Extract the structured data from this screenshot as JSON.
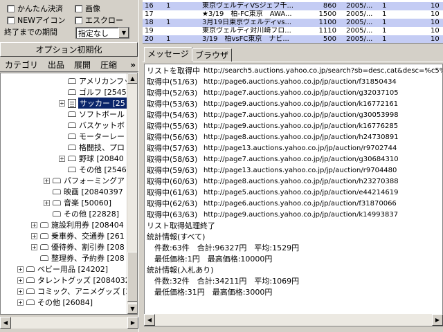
{
  "filters": {
    "row1": [
      {
        "label": "かんたん決済"
      },
      {
        "label": "画像"
      }
    ],
    "row2": [
      {
        "label": "NEWアイコン"
      },
      {
        "label": "エスクロー"
      }
    ],
    "period_label": "終了までの期間",
    "period_value": "指定なし"
  },
  "reset_button": "オプション初期化",
  "left_tabs": [
    "カテゴリ",
    "出品",
    "展開",
    "圧縮"
  ],
  "left_tabs_more": "»",
  "tree": [
    {
      "text": "アメリカンフッ",
      "level": 4,
      "expander": ""
    },
    {
      "text": "ゴルフ [2545",
      "level": 4,
      "expander": ""
    },
    {
      "text": "サッカー [25",
      "level": 4,
      "expander": "+",
      "selected": true
    },
    {
      "text": "ソフトボール",
      "level": 4,
      "expander": ""
    },
    {
      "text": "バスケットボ",
      "level": 4,
      "expander": ""
    },
    {
      "text": "モーターレー",
      "level": 4,
      "expander": ""
    },
    {
      "text": "格闘技、プロ",
      "level": 4,
      "expander": ""
    },
    {
      "text": "野球 [20840",
      "level": 4,
      "expander": "+"
    },
    {
      "text": "その他 [2546",
      "level": 4,
      "expander": ""
    },
    {
      "text": "パフォーミングア",
      "level": 3,
      "expander": "+"
    },
    {
      "text": "映画 [20840397",
      "level": 3,
      "expander": ""
    },
    {
      "text": "音楽 [50060]",
      "level": 3,
      "expander": "+"
    },
    {
      "text": "その他 [22828]",
      "level": 3,
      "expander": ""
    },
    {
      "text": "施設利用券 [208404",
      "level": 2,
      "expander": "+"
    },
    {
      "text": "乗車券、交通券 [261",
      "level": 2,
      "expander": "+"
    },
    {
      "text": "優待券、割引券 [208",
      "level": 2,
      "expander": "+"
    },
    {
      "text": "整理券、予約券 [208",
      "level": 2,
      "expander": ""
    },
    {
      "text": "ベビー用品 [24202]",
      "level": 1,
      "expander": "+"
    },
    {
      "text": "タレントグッズ [2084032",
      "level": 1,
      "expander": "+"
    },
    {
      "text": "コミック、アニメグッズ [2",
      "level": 1,
      "expander": "+"
    },
    {
      "text": "その他 [26084]",
      "level": 1,
      "expander": "+"
    }
  ],
  "table": {
    "rows": [
      {
        "c0": "16",
        "c1": "1",
        "c2": "東京ヴェルディVSジェフ千...",
        "c3": "860",
        "c4": "2005/...",
        "c5": "1",
        "c6": "10",
        "selected": true
      },
      {
        "c0": "17",
        "c1": "",
        "c2": "★3/19　柏-FC東京　AWA...",
        "c3": "1500",
        "c4": "2005/...",
        "c5": "1",
        "c6": "10",
        "selected": false
      },
      {
        "c0": "18",
        "c1": "1",
        "c2": "3月19日東京ヴェルディvs...",
        "c3": "1100",
        "c4": "2005/...",
        "c5": "1",
        "c6": "10",
        "selected": true
      },
      {
        "c0": "19",
        "c1": "",
        "c2": "東京ヴェルディ対川崎フロ...",
        "c3": "1110",
        "c4": "2005/...",
        "c5": "1",
        "c6": "10",
        "selected": false
      },
      {
        "c0": "20",
        "c1": "1",
        "c2": "3/19　柏vsFC東京　ナビ...",
        "c3": "500",
        "c4": "2005/...",
        "c5": "1",
        "c6": "10",
        "selected": true
      }
    ]
  },
  "right_tabs": [
    "メッセージ",
    "ブラウザ"
  ],
  "log": [
    {
      "prefix": "リストを取得中",
      "url": "http://search5.auctions.yahoo.co.jp/search?sb=desc,cat&desc=%c5%"
    },
    {
      "prefix": "取得中(51/63)",
      "url": "http://page6.auctions.yahoo.co.jp/jp/auction/f31850434"
    },
    {
      "prefix": "取得中(52/63)",
      "url": "http://page7.auctions.yahoo.co.jp/jp/auction/g32037105"
    },
    {
      "prefix": "取得中(53/63)",
      "url": "http://page9.auctions.yahoo.co.jp/jp/auction/k16772161"
    },
    {
      "prefix": "取得中(54/63)",
      "url": "http://page7.auctions.yahoo.co.jp/jp/auction/g30053998"
    },
    {
      "prefix": "取得中(55/63)",
      "url": "http://page9.auctions.yahoo.co.jp/jp/auction/k16776285"
    },
    {
      "prefix": "取得中(56/63)",
      "url": "http://page8.auctions.yahoo.co.jp/jp/auction/h24730891"
    },
    {
      "prefix": "取得中(57/63)",
      "url": "http://page13.auctions.yahoo.co.jp/jp/auction/r9702744"
    },
    {
      "prefix": "取得中(58/63)",
      "url": "http://page7.auctions.yahoo.co.jp/jp/auction/g30684310"
    },
    {
      "prefix": "取得中(59/63)",
      "url": "http://page13.auctions.yahoo.co.jp/jp/auction/r9704480"
    },
    {
      "prefix": "取得中(60/63)",
      "url": "http://page8.auctions.yahoo.co.jp/jp/auction/h23270388"
    },
    {
      "prefix": "取得中(61/63)",
      "url": "http://page5.auctions.yahoo.co.jp/jp/auction/e44214619"
    },
    {
      "prefix": "取得中(62/63)",
      "url": "http://page6.auctions.yahoo.co.jp/jp/auction/f31870066"
    },
    {
      "prefix": "取得中(63/63)",
      "url": "http://page9.auctions.yahoo.co.jp/jp/auction/k14993837"
    },
    {
      "prefix": "リスト取得処理終了",
      "url": ""
    },
    {
      "prefix": "統計情報(すべて)",
      "url": ""
    },
    {
      "prefix": "　件数:63件　合計:96327円　平均:1529円",
      "url": ""
    },
    {
      "prefix": "　最低価格:1円　最高価格:10000円",
      "url": ""
    },
    {
      "prefix": "統計情報(入札あり)",
      "url": ""
    },
    {
      "prefix": "　件数:32件　合計:34211円　平均:1069円",
      "url": ""
    },
    {
      "prefix": "　最低価格:31円　最高価格:3000円",
      "url": ""
    }
  ]
}
